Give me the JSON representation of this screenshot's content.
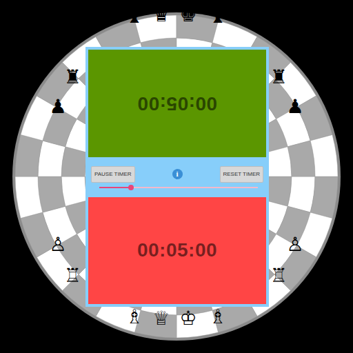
{
  "board": {
    "pieces": [
      {
        "glyph": "♝"
      },
      {
        "glyph": "♛"
      },
      {
        "glyph": "♚"
      },
      {
        "glyph": "♝"
      },
      {
        "glyph": "♜"
      },
      {
        "glyph": "♟"
      },
      {
        "glyph": "♜"
      },
      {
        "glyph": "♟"
      },
      {
        "glyph": "♙"
      },
      {
        "glyph": "♖"
      },
      {
        "glyph": "♙"
      },
      {
        "glyph": "♖"
      },
      {
        "glyph": "♗"
      },
      {
        "glyph": "♕"
      },
      {
        "glyph": "♔"
      },
      {
        "glyph": "♗"
      }
    ]
  },
  "timers": [
    {
      "time": "00:05:00",
      "color": "#5b9600",
      "flipped": true
    },
    {
      "time": "00:05:00",
      "color": "#ff4545",
      "flipped": false
    }
  ],
  "controls": {
    "pause": "PAUSE TIMER",
    "info": "i",
    "reset": "RESET TIMER",
    "slider": {
      "level": 0.2
    }
  }
}
